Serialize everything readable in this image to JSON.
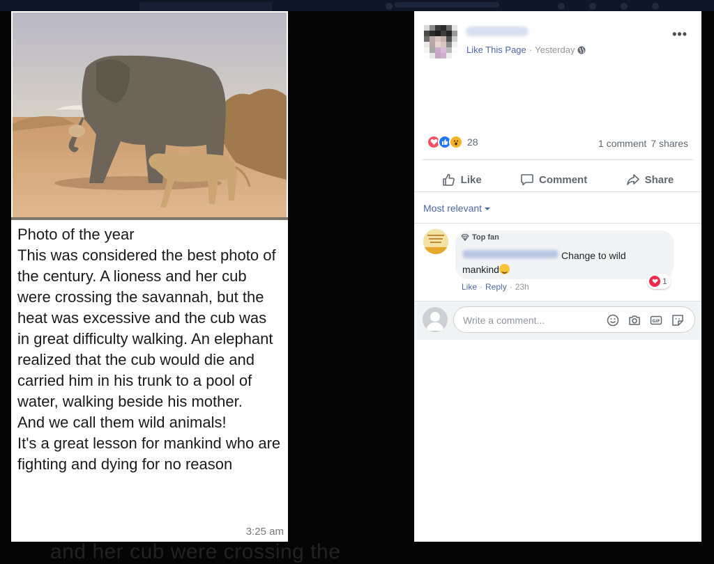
{
  "message": {
    "lines": "Photo of the year\nThis was considered the best photo of the century.  A lioness and her cub were crossing the savannah, but the heat was excessive and the cub was in great difficulty walking.  An elephant realized that the cub would die and carried him in his trunk to a pool of water, walking beside his mother.\nAnd we call them wild animals!\nIt's a great lesson for mankind who are fighting and dying for no reason",
    "time": "3:25 am"
  },
  "background_text": "and her cub were crossing the",
  "post": {
    "like_page": "Like This Page",
    "separator": "·",
    "time": "Yesterday",
    "reaction_count": "28",
    "comments": "1 comment",
    "shares": "7 shares",
    "actions": {
      "like": "Like",
      "comment": "Comment",
      "share": "Share"
    }
  },
  "comments_section": {
    "filter": "Most relevant",
    "comment": {
      "badge": "Top fan",
      "text": "Change to wild mankind",
      "reaction_count": "1",
      "like": "Like",
      "reply": "Reply",
      "age": "23h"
    },
    "write_placeholder": "Write a comment..."
  },
  "colors": {
    "link": "#4b67a1",
    "love": "#f25268",
    "like": "#2078f4",
    "wow": "#f7b125"
  },
  "icons": [
    "globe-icon",
    "more-icon",
    "like-thumb-icon",
    "comment-icon",
    "share-icon",
    "caret-down-icon",
    "top-fan-icon",
    "emoji-icon",
    "camera-icon",
    "gif-icon",
    "sticker-icon"
  ]
}
